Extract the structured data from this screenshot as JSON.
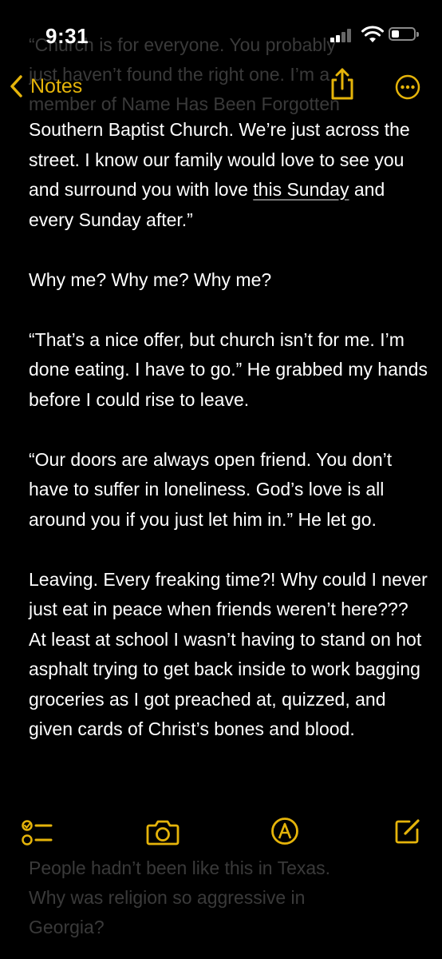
{
  "status_bar": {
    "time": "9:31"
  },
  "nav": {
    "back_label": "Notes"
  },
  "ghost_top": [
    "“Church is for everyone. You probably",
    "just haven’t found the right one. I’m a",
    "member of Name Has Been Forgotten"
  ],
  "note": {
    "p1_before": "Southern Baptist Church. We’re just across the street. I know our family would love to see you and surround you with love ",
    "p1_link": "this Sunday",
    "p1_after": " and every Sunday after.”",
    "p2": "Why me? Why me? Why me?",
    "p3": "“That’s a nice offer, but church isn’t for me. I’m done eating. I have to go.” He grabbed my hands before I could rise to leave.",
    "p4": "“Our doors are always open friend. You don’t have to suffer in loneliness. God’s love is all around you if you just let him in.” He let go.",
    "p5": "Leaving. Every freaking time?! Why could I never just eat in peace when friends weren’t here??? At least at school I wasn’t having to stand on hot asphalt trying to get back inside to work bagging groceries as I got preached at, quizzed, and given cards of Christ’s bones and blood."
  },
  "ghost_bottom": [
    "People hadn’t been like this in Texas.",
    "Why was religion so aggressive in",
    "Georgia?"
  ],
  "colors": {
    "accent": "#e5b40a",
    "background": "#000000",
    "text": "#ffffff"
  },
  "icons": {
    "back": "chevron-left-icon",
    "share": "share-icon",
    "more": "ellipsis-circle-icon",
    "checklist": "checklist-icon",
    "camera": "camera-icon",
    "markup": "markup-pen-icon",
    "compose": "compose-icon"
  }
}
